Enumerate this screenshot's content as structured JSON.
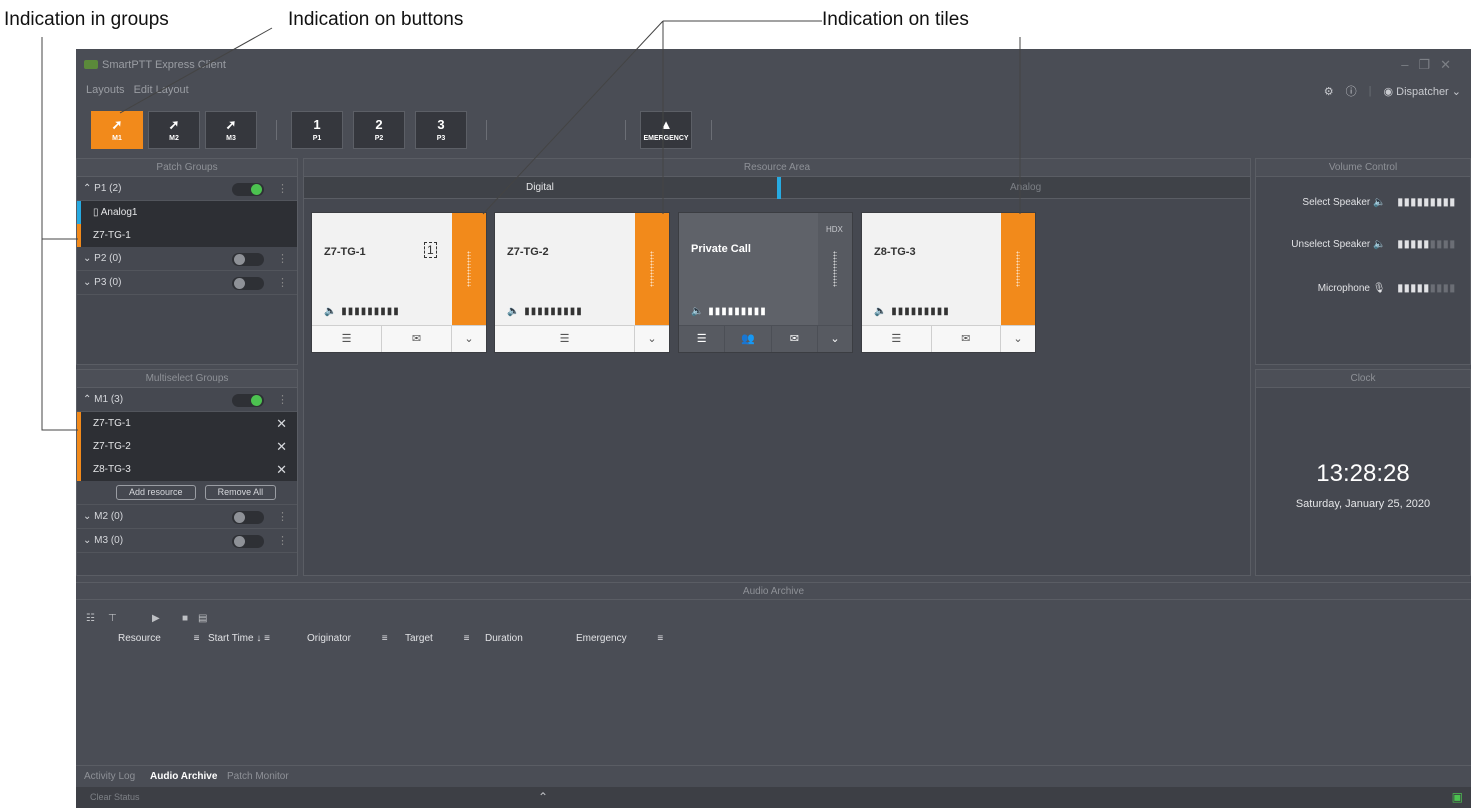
{
  "callouts": {
    "groups": "Indication in groups",
    "buttons": "Indication on buttons",
    "tiles": "Indication on tiles"
  },
  "app": {
    "title": "SmartPTT Express Client",
    "menu": [
      "Layouts",
      "Edit Layout"
    ],
    "user": "Dispatcher"
  },
  "toolbar": {
    "buttons": [
      {
        "label": "M1",
        "icon": "multiselect-icon"
      },
      {
        "label": "M2",
        "icon": "multiselect-icon"
      },
      {
        "label": "M3",
        "icon": "multiselect-icon"
      },
      {
        "label": "P1",
        "icon": "patch-1-icon",
        "num": "1"
      },
      {
        "label": "P2",
        "icon": "patch-2-icon",
        "num": "2"
      },
      {
        "label": "P3",
        "icon": "patch-3-icon",
        "num": "3"
      },
      {
        "label": "EMERGENCY",
        "icon": "warning-icon"
      }
    ]
  },
  "patch_groups": {
    "title": "Patch Groups",
    "groups": [
      {
        "name": "P1 (2)",
        "on": true,
        "members": [
          "Analog1",
          "Z7-TG-1"
        ]
      },
      {
        "name": "P2 (0)",
        "on": false
      },
      {
        "name": "P3 (0)",
        "on": false
      }
    ]
  },
  "multiselect_groups": {
    "title": "Multiselect Groups",
    "groups": [
      {
        "name": "M1 (3)",
        "on": true,
        "members": [
          "Z7-TG-1",
          "Z7-TG-2",
          "Z8-TG-3"
        ]
      },
      {
        "name": "M2 (0)",
        "on": false
      },
      {
        "name": "M3 (0)",
        "on": false
      }
    ],
    "add_resource": "Add resource",
    "remove_all": "Remove All"
  },
  "resource_area": {
    "title": "Resource Area",
    "tabs": [
      "Digital",
      "Analog"
    ],
    "tiles": [
      {
        "name": "Z7-TG-1"
      },
      {
        "name": "Z7-TG-2"
      },
      {
        "name": "Private Call",
        "badge": "HDX"
      },
      {
        "name": "Z8-TG-3"
      }
    ]
  },
  "volume_control": {
    "title": "Volume Control",
    "rows": [
      "Select Speaker",
      "Unselect Speaker",
      "Microphone"
    ]
  },
  "clock": {
    "title": "Clock",
    "time": "13:28:28",
    "date": "Saturday, January 25, 2020"
  },
  "audio_archive": {
    "title": "Audio Archive",
    "columns": [
      "Resource",
      "Start Time",
      "Originator",
      "Target",
      "Duration",
      "Emergency"
    ]
  },
  "bottom_tabs": [
    "Activity Log",
    "Audio Archive",
    "Patch Monitor"
  ],
  "status": {
    "clear": "Clear Status"
  }
}
